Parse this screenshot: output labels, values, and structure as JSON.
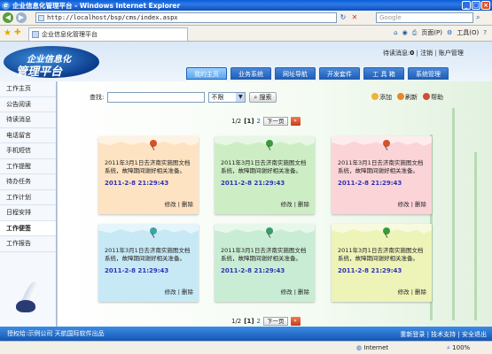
{
  "window": {
    "title": "企业信息化管理平台 - Windows Internet Explorer"
  },
  "browser": {
    "address": "http://localhost/bsp/cms/index.aspx",
    "search_placeholder": "Google",
    "tab_title": "企业信息化管理平台",
    "toolbar": {
      "page": "页面(P)",
      "tools": "工具(O)"
    },
    "status": {
      "zone": "Internet",
      "zoom": "100%"
    }
  },
  "app": {
    "logo": {
      "line1": "企业信息化",
      "line2": "管理平台"
    },
    "welcome": {
      "prefix": "待读消息:",
      "count": "0",
      "logout": "注销",
      "account": "账户管理"
    },
    "nav": [
      {
        "label": "我的主页",
        "active": true
      },
      {
        "label": "业务系统",
        "active": false
      },
      {
        "label": "网址导航",
        "active": false
      },
      {
        "label": "开发套件",
        "active": false
      },
      {
        "label": "工 具 箱",
        "active": false
      },
      {
        "label": "系统管理",
        "active": false
      }
    ],
    "sidebar": [
      {
        "label": "工作主页",
        "active": false
      },
      {
        "label": "公告阅读",
        "active": false
      },
      {
        "label": "待读消息",
        "active": false
      },
      {
        "label": "电话留言",
        "active": false
      },
      {
        "label": "手机短信",
        "active": false
      },
      {
        "label": "工作提醒",
        "active": false
      },
      {
        "label": "待办任务",
        "active": false
      },
      {
        "label": "工作计划",
        "active": false
      },
      {
        "label": "日程安排",
        "active": false
      },
      {
        "label": "工作便签",
        "active": true
      },
      {
        "label": "工作报告",
        "active": false
      }
    ],
    "search": {
      "label": "查找:",
      "value": "",
      "select": "不限",
      "button": "搜索"
    },
    "actions": {
      "add": "添加",
      "refresh": "刷新",
      "help": "帮助"
    },
    "pager": {
      "range": "1/2",
      "current": "[1]",
      "page2": "2",
      "next": "下一页"
    },
    "notes": [
      {
        "text": "2011年3月1日去济南实施图文档系统，故障期间谢好相关准备。",
        "date": "2011-2-8 21:29:43",
        "edit": "修改",
        "delete": "删除",
        "color": "#fde3c2",
        "pin": "#d8502a"
      },
      {
        "text": "2011年3月1日去济南实施图文档系统，故障期间谢好相关准备。",
        "date": "2011-2-8 21:29:43",
        "edit": "修改",
        "delete": "删除",
        "color": "#cdeec5",
        "pin": "#3a9a3a"
      },
      {
        "text": "2011年3月1日去济南实施图文档系统，故障期间谢好相关准备。",
        "date": "2011-2-8 21:29:43",
        "edit": "修改",
        "delete": "删除",
        "color": "#fbd4d8",
        "pin": "#d8502a"
      },
      {
        "text": "2011年3月1日去济南实施图文档系统，故障期间谢好相关准备。",
        "date": "2011-2-8 21:29:43",
        "edit": "修改",
        "delete": "删除",
        "color": "#c7e9f6",
        "pin": "#3aa6a6"
      },
      {
        "text": "2011年3月1日去济南实施图文档系统，故障期间谢好相关准备。",
        "date": "2011-2-8 21:29:43",
        "edit": "修改",
        "delete": "删除",
        "color": "#c9edd4",
        "pin": "#3a9a6a"
      },
      {
        "text": "2011年3月1日去济南实施图文档系统，故障期间谢好相关准备。",
        "date": "2011-2-8 21:29:43",
        "edit": "修改",
        "delete": "删除",
        "color": "#eef4b8",
        "pin": "#3a9a3a"
      }
    ],
    "footer": {
      "left": "授权给:示例公司   天航国际软件出品",
      "right": "重新登录 | 技术支持 | 安全退出"
    }
  }
}
